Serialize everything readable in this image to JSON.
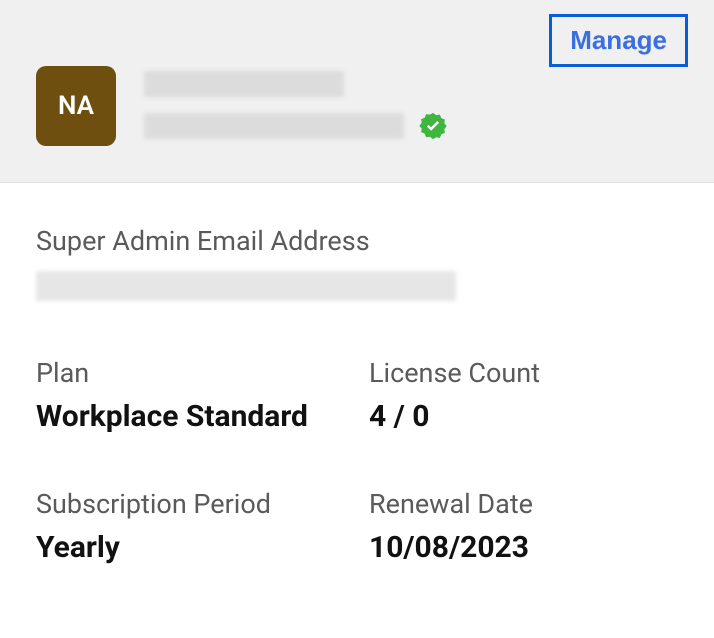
{
  "header": {
    "manage_label": "Manage",
    "avatar_initials": "NA"
  },
  "super_admin_label": "Super Admin Email Address",
  "fields": {
    "plan": {
      "label": "Plan",
      "value": "Workplace Standard"
    },
    "license_count": {
      "label": "License Count",
      "value": "4 / 0"
    },
    "subscription_period": {
      "label": "Subscription Period",
      "value": "Yearly"
    },
    "renewal_date": {
      "label": "Renewal Date",
      "value": "10/08/2023"
    }
  }
}
